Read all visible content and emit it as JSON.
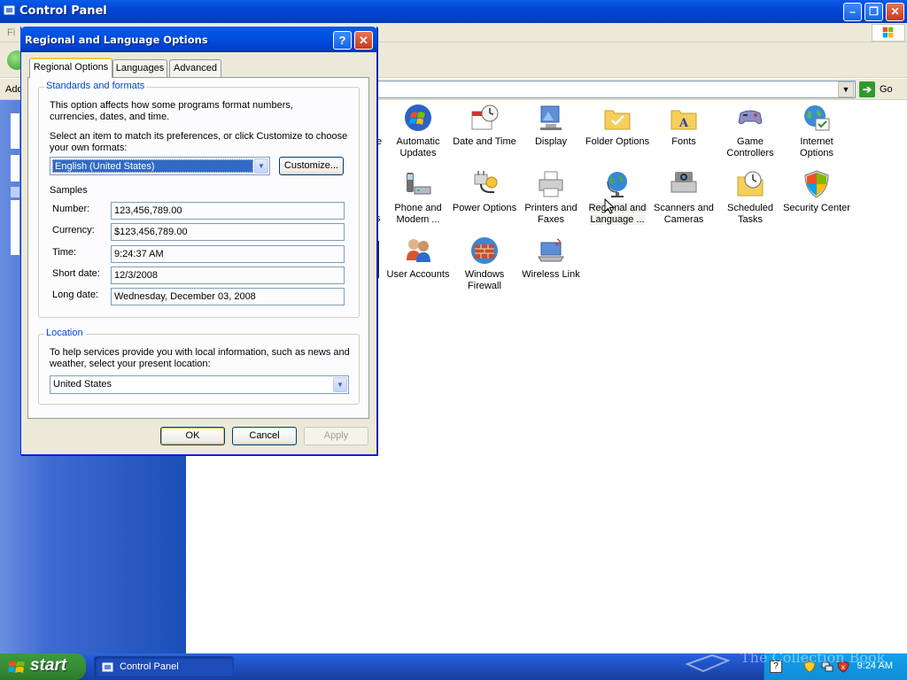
{
  "window": {
    "title": "Control Panel",
    "menu_file": "Fi",
    "address_label": "Add",
    "go_label": "Go",
    "minimize_icon": "minimize-icon",
    "restore_icon": "restore-icon",
    "close_icon": "close-icon"
  },
  "icons": {
    "partial_row1": "e",
    "partial_row2": "s",
    "automatic_updates": "Automatic Updates",
    "date_and_time": "Date and Time",
    "display": "Display",
    "folder_options": "Folder Options",
    "fonts": "Fonts",
    "game_controllers": "Game Controllers",
    "internet_options": "Internet Options",
    "phone_and_modem": "Phone and Modem ...",
    "power_options": "Power Options",
    "printers_and_faxes": "Printers and Faxes",
    "regional_and_language": "Regional and Language ...",
    "scanners_and_cameras": "Scanners and Cameras",
    "scheduled_tasks": "Scheduled Tasks",
    "security_center": "Security Center",
    "user_accounts": "User Accounts",
    "windows_firewall": "Windows Firewall",
    "wireless_link": "Wireless Link"
  },
  "dialog": {
    "title": "Regional and Language Options",
    "help_label": "?",
    "close_label": "✕",
    "tabs": [
      "Regional Options",
      "Languages",
      "Advanced"
    ],
    "standards": {
      "legend": "Standards and formats",
      "description": "This option affects how some programs format numbers, currencies, dates, and time.",
      "instruction": "Select an item to match its preferences, or click Customize to choose your own formats:",
      "selected_locale": "English (United States)",
      "customize_label": "Customize...",
      "samples_label": "Samples",
      "samples": [
        {
          "label": "Number:",
          "value": "123,456,789.00"
        },
        {
          "label": "Currency:",
          "value": "$123,456,789.00"
        },
        {
          "label": "Time:",
          "value": "9:24:37 AM"
        },
        {
          "label": "Short date:",
          "value": "12/3/2008"
        },
        {
          "label": "Long date:",
          "value": "Wednesday, December 03, 2008"
        }
      ]
    },
    "location": {
      "legend": "Location",
      "description": "To help services provide you with local information, such as news and weather, select your present location:",
      "selected_location": "United States"
    },
    "buttons": {
      "ok": "OK",
      "cancel": "Cancel",
      "apply": "Apply"
    }
  },
  "taskbar": {
    "start_label": "start",
    "task_control_panel": "Control Panel",
    "clock": "9:24 AM",
    "watermark": "The Collection Book"
  },
  "colors": {
    "xp_blue": "#0046d5",
    "start_green": "#388e38",
    "dialog_face": "#ece9d8",
    "group_legend": "#0046d5",
    "tray_blue": "#0e8fd8"
  }
}
